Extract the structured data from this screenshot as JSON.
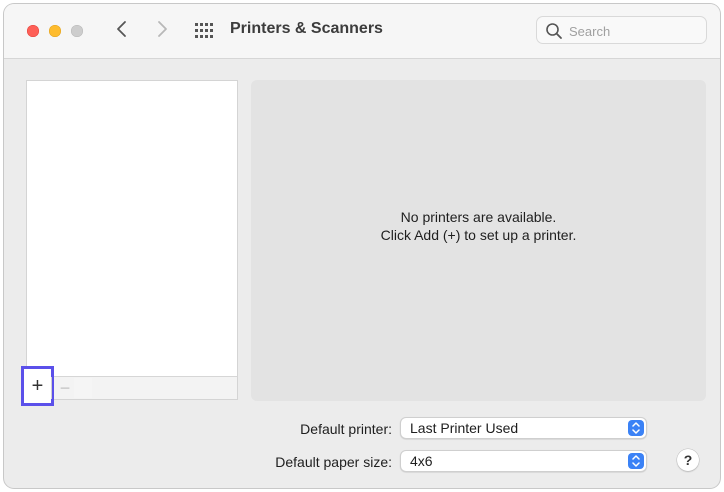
{
  "window": {
    "title": "Printers & Scanners"
  },
  "toolbar": {
    "back_icon": "chevron-left-icon",
    "forward_icon": "chevron-right-icon",
    "show_all_icon": "grid-icon"
  },
  "search": {
    "placeholder": "Search",
    "value": ""
  },
  "printer_list": {
    "items": [],
    "add_label": "+",
    "remove_label": "−"
  },
  "detail": {
    "empty_line1": "No printers are available.",
    "empty_line2": "Click Add (+) to set up a printer."
  },
  "settings": {
    "default_printer_label": "Default printer:",
    "default_printer_value": "Last Printer Used",
    "paper_size_label": "Default paper size:",
    "paper_size_value": "4x6"
  },
  "help": {
    "label": "?"
  },
  "colors": {
    "close": "#fe5f57",
    "minimize": "#febc2e",
    "zoom_disabled": "#cdcdcd",
    "accent": "#3b82f6",
    "highlight": "#5b50ea"
  }
}
